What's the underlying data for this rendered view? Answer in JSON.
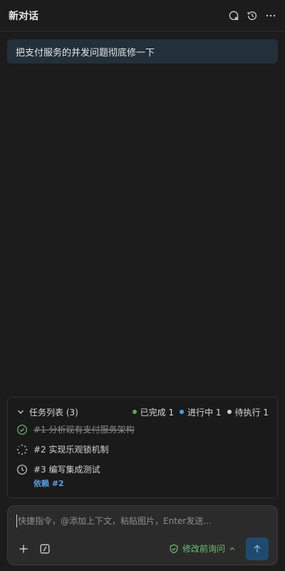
{
  "header": {
    "title": "新对话",
    "actions": [
      "new-chat-icon",
      "history-icon",
      "more-icon"
    ]
  },
  "conversation": {
    "user_message": "把支付服务的并发问题彻底修一下"
  },
  "tasks": {
    "title": "任务列表 (3)",
    "stats": {
      "done": {
        "label": "已完成 1",
        "color": "#4caf50"
      },
      "in_progress": {
        "label": "进行中 1",
        "color": "#4a9fe8"
      },
      "pending": {
        "label": "待执行 1",
        "color": "#cfcfcf"
      }
    },
    "items": [
      {
        "text": "#1 分析现有支付服务架构",
        "status": "done",
        "icon": "check-circle-icon"
      },
      {
        "text": "#2 实现乐观锁机制",
        "status": "in_progress",
        "icon": "spinner-icon"
      },
      {
        "text": "#3 编写集成测试",
        "status": "pending",
        "icon": "clock-icon",
        "dependency": "依赖 #2"
      }
    ]
  },
  "input": {
    "placeholder": "快捷指令，@添加上下文，粘贴图片，Enter发送...",
    "value": "",
    "mode_label": "修改前询问",
    "tools": [
      "plus-icon",
      "slash-command-icon"
    ]
  },
  "colors": {
    "background": "#1c1c1c",
    "user_bubble": "#23303a",
    "accent_green": "#6fbf73",
    "accent_blue": "#5aa0e6",
    "send_button": "#1f4a6e"
  }
}
